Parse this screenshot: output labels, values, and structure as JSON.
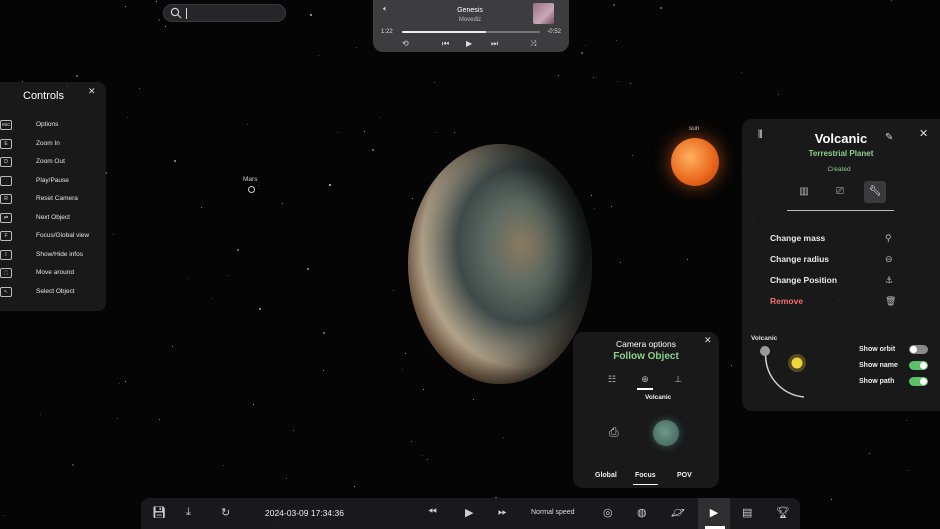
{
  "search": {
    "placeholder": ""
  },
  "music": {
    "volume_icon": "speaker-icon",
    "title": "Genesis",
    "artist": "Movediz",
    "time_elapsed": "1:22",
    "time_remaining": "-0:52",
    "progress": 0.61,
    "controls": [
      "repeat-icon",
      "previous-icon",
      "play-icon",
      "next-icon",
      "shuffle-icon"
    ]
  },
  "controls": {
    "title": "Controls",
    "items": [
      {
        "key": "esc",
        "label": "Options"
      },
      {
        "key": "E",
        "label": "Zoom In"
      },
      {
        "key": "D",
        "label": "Zoom Out"
      },
      {
        "key": "",
        "label": "Play/Pause"
      },
      {
        "key": "R",
        "label": "Reset Camera"
      },
      {
        "key": "⇄",
        "label": "Next Object"
      },
      {
        "key": "F",
        "label": "Focus/Global view"
      },
      {
        "key": "I",
        "label": "Show/Hide infos"
      },
      {
        "key": "⬚",
        "label": "Move around"
      },
      {
        "key": "↖",
        "label": "Select Object"
      }
    ]
  },
  "scene": {
    "mars_label": "Mars",
    "sun_label": "sun"
  },
  "object_panel": {
    "name": "Volcanic",
    "kind": "Terrestrial Planet",
    "status": "Created",
    "actions": [
      {
        "label": "Change mass",
        "icon": "weight-icon"
      },
      {
        "label": "Change radius",
        "icon": "radius-icon"
      },
      {
        "label": "Change Position",
        "icon": "position-icon"
      },
      {
        "label": "Remove",
        "icon": "trash-icon"
      }
    ],
    "orbit_label": "Volcanic",
    "toggles": [
      {
        "label": "Show orbit",
        "on": false
      },
      {
        "label": "Show name",
        "on": true
      },
      {
        "label": "Show path",
        "on": true
      }
    ],
    "colors": {
      "green": "#8bd18b",
      "red": "#ef7070",
      "toggle_on": "#5cc06a"
    }
  },
  "camera_panel": {
    "title": "Camera options",
    "mode": "Follow Object",
    "target": "Volcanic",
    "modes": [
      "Global",
      "Focus",
      "POV"
    ],
    "active_mode": "Focus"
  },
  "bottom_bar": {
    "datetime": "2024-03-09 17:34:36",
    "speed": "Normal speed"
  }
}
